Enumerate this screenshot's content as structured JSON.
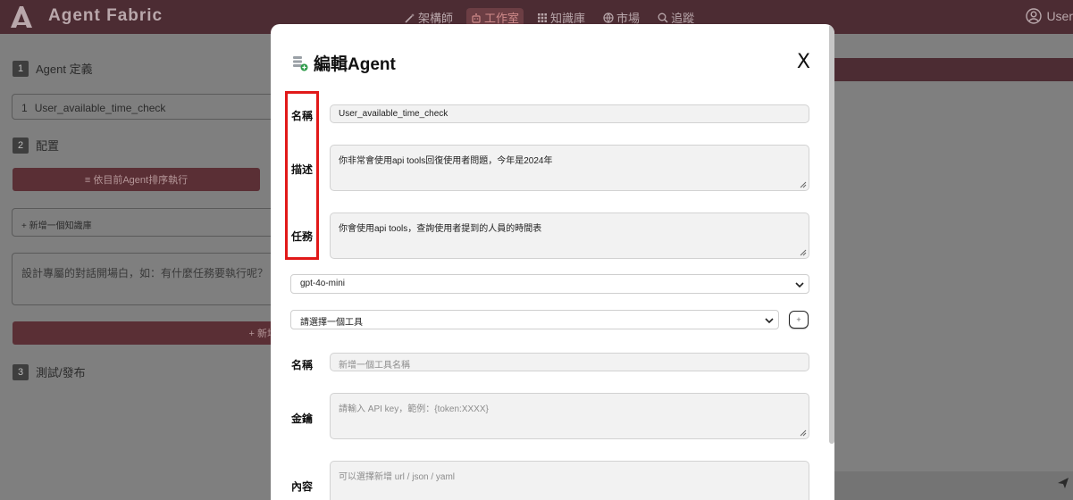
{
  "app": {
    "title": "Agent Fabric",
    "user_label": "User"
  },
  "nav": [
    {
      "label": "架構師",
      "icon": "wand-icon"
    },
    {
      "label": "工作室",
      "icon": "robot-icon",
      "active": true
    },
    {
      "label": "知識庫",
      "icon": "grid-icon"
    },
    {
      "label": "市場",
      "icon": "globe-icon"
    },
    {
      "label": "追蹤",
      "icon": "search-icon"
    }
  ],
  "background": {
    "step1": {
      "num": "1",
      "label": "Agent 定義"
    },
    "agent_name_prefix": "1",
    "agent_name": "User_available_time_check",
    "step2": {
      "num": "2",
      "label": "配置"
    },
    "sort_button": "≡ 依目前Agent排序執行",
    "add_kb": "+ 新增一個知識庫",
    "greeting_placeholder": "設計專屬的對話開場白，如：有什麼任務要執行呢？",
    "add_button": "+ 新增",
    "step3": {
      "num": "3",
      "label": "測試/發布"
    }
  },
  "modal": {
    "title": "編輯Agent",
    "close_label": "X",
    "name_label": "名稱",
    "name_value": "User_available_time_check",
    "desc_label": "描述",
    "desc_value": "你非常會使用api tools回復使用者問題，今年是2024年",
    "task_label": "任務",
    "task_value": "你會使用api tools，查詢使用者提到的人員的時間表",
    "model_value": "gpt-4o-mini",
    "tool_select": "請選擇一個工具",
    "add_tool_label": "+",
    "tool_name_label": "名稱",
    "tool_name_placeholder": "新增一個工具名稱",
    "key_label": "金鑰",
    "key_placeholder": "請輸入 API key，範例：{token:XXXX}",
    "content_label": "內容",
    "content_placeholder": "可以選擇新增 url / json / yaml"
  },
  "colors": {
    "topbar": "#4c2c33",
    "accent": "#5a2f35",
    "highlight": "#e11919"
  }
}
